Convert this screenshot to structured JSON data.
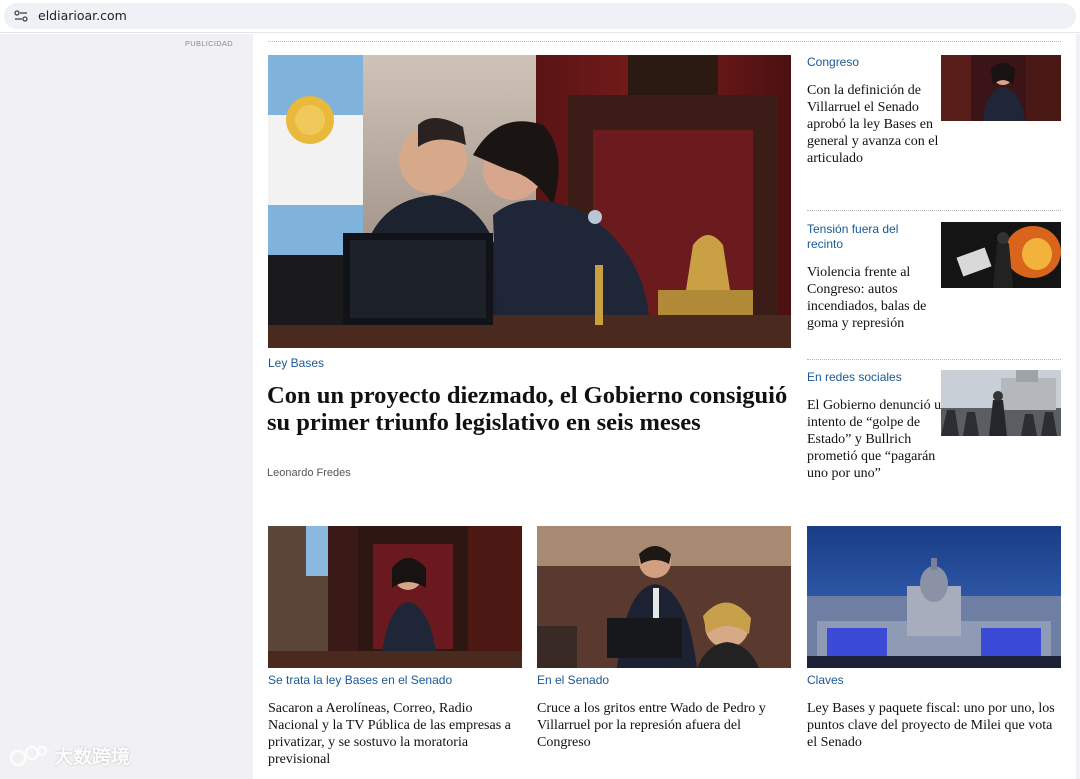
{
  "browser": {
    "url": "eldiarioar.com"
  },
  "ad": {
    "label": "PUBLICIDAD"
  },
  "main_story": {
    "kicker": "Ley Bases",
    "title": "Con un proyecto diezmado, el Gobierno consiguió su primer triunfo legislativo en seis meses",
    "author": "Leonardo Fredes"
  },
  "side_stories": [
    {
      "kicker": "Congreso",
      "title": "Con la definición de Villarruel el Senado aprobó la ley Bases en general y avanza con el articulado"
    },
    {
      "kicker": "Tensión fuera del recinto",
      "title": "Violencia frente al Congreso: autos incendiados, balas de goma y represión"
    },
    {
      "kicker": "En redes sociales",
      "title": "El Gobierno denunció un intento de “golpe de Estado” y Bullrich prometió que “pagarán uno por uno”"
    }
  ],
  "bottom_stories": [
    {
      "kicker": "Se trata la ley Bases en el Senado",
      "title": "Sacaron a Aerolíneas, Correo, Radio Nacional y la TV Pública de las empresas a privatizar, y se sostuvo la moratoria previsional"
    },
    {
      "kicker": "En el Senado",
      "title": "Cruce a los gritos entre Wado de Pedro y Villarruel por la represión afuera del Congreso"
    },
    {
      "kicker": "Claves",
      "title": "Ley Bases y paquete fiscal: uno por uno, los puntos clave del proyecto de Milei que vota el Senado"
    }
  ],
  "watermark": {
    "text": "大数跨境"
  },
  "colors": {
    "kicker": "#1a5896",
    "ad_background": "#f1f1f3"
  }
}
